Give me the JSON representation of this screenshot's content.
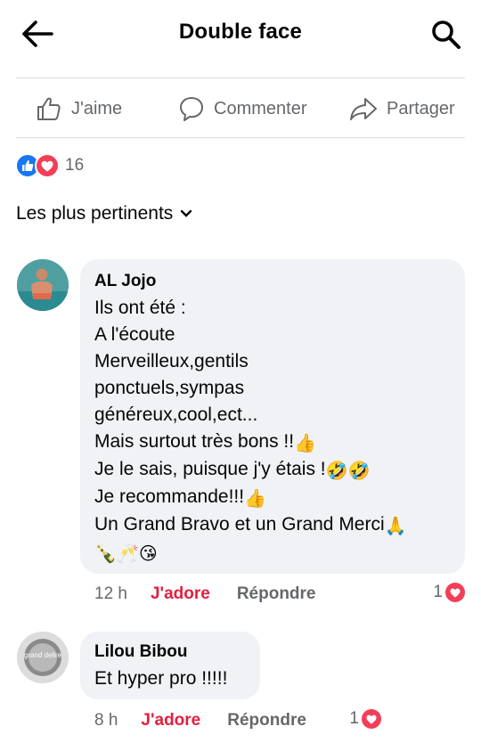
{
  "header": {
    "title": "Double face"
  },
  "actions": {
    "like": "J'aime",
    "comment": "Commenter",
    "share": "Partager"
  },
  "reactions": {
    "count": "16"
  },
  "sort": {
    "label": "Les plus pertinents"
  },
  "comments": [
    {
      "author": "AL Jojo",
      "lines": [
        "Ils ont été :",
        "A l'écoute",
        "Merveilleux,gentils",
        "ponctuels,sympas",
        "généreux,cool,ect...",
        "Mais surtout très bons !!",
        "Je le sais, puisque j'y étais !",
        "Je recommande!!!",
        "Un Grand Bravo et un Grand Merci"
      ],
      "time": "12 h",
      "react_label": "J'adore",
      "reply_label": "Répondre",
      "like_count": "1"
    },
    {
      "author": "Lilou Bibou",
      "lines": [
        "Et hyper pro !!!!!"
      ],
      "time": "8 h",
      "react_label": "J'adore",
      "reply_label": "Répondre",
      "like_count": "1",
      "avatar_text": "grand delire"
    }
  ],
  "colors": {
    "like_blue": "#1877f2",
    "love_red": "#f33e58",
    "adore_red": "#e41e3f",
    "bubble_bg": "#f0f2f5"
  }
}
